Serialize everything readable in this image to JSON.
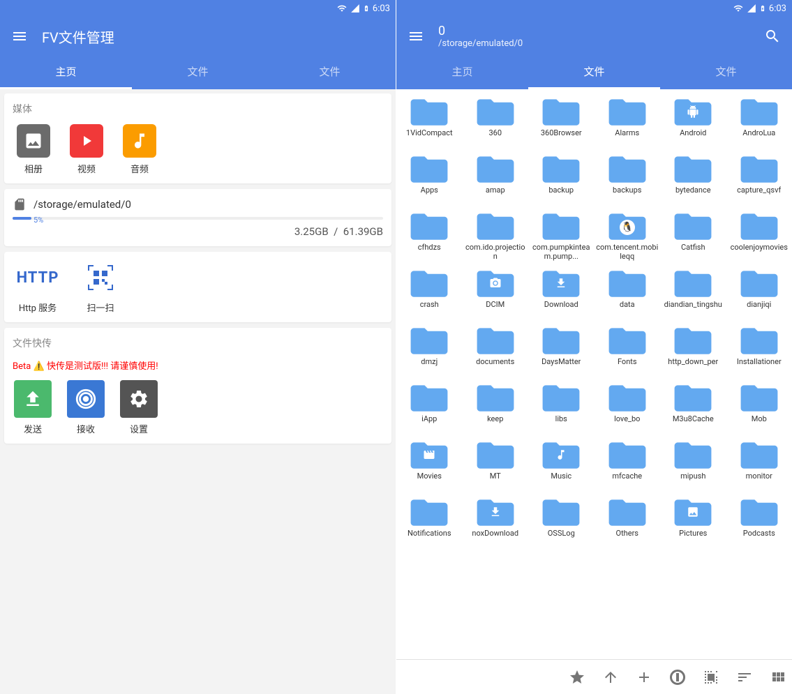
{
  "status": {
    "time": "6:03"
  },
  "phone1": {
    "title": "FV文件管理",
    "tabs": [
      "主页",
      "文件",
      "文件"
    ],
    "activeTab": 0,
    "media": {
      "title": "媒体",
      "items": [
        {
          "label": "相册",
          "bg": "#6b6b6b",
          "type": "image"
        },
        {
          "label": "视频",
          "bg": "#f13939",
          "type": "video"
        },
        {
          "label": "音频",
          "bg": "#fb9c00",
          "type": "audio"
        }
      ]
    },
    "storage": {
      "path": "/storage/emulated/0",
      "percent": "5%",
      "used": "3.25GB",
      "total": "61.39GB"
    },
    "tools": [
      {
        "label": "Http 服务",
        "type": "http"
      },
      {
        "label": "扫一扫",
        "type": "qr"
      }
    ],
    "transfer": {
      "title": "文件快传",
      "beta": "Beta ⚠️ 快传是测试版!!! 请谨慎使用!",
      "actions": [
        {
          "label": "发送",
          "bg": "#4bb96d",
          "type": "upload"
        },
        {
          "label": "接收",
          "bg": "#3a78d4",
          "type": "receive"
        },
        {
          "label": "设置",
          "bg": "#545454",
          "type": "settings"
        }
      ]
    }
  },
  "phone2": {
    "title": "0",
    "subtitle": "/storage/emulated/0",
    "tabs": [
      "主页",
      "文件",
      "文件"
    ],
    "activeTab": 1,
    "folders": [
      {
        "name": "1VidCompact"
      },
      {
        "name": "360"
      },
      {
        "name": "360Browser"
      },
      {
        "name": "Alarms"
      },
      {
        "name": "Android",
        "overlay": "android"
      },
      {
        "name": "AndroLua"
      },
      {
        "name": "Apps"
      },
      {
        "name": "amap"
      },
      {
        "name": "backup"
      },
      {
        "name": "backups"
      },
      {
        "name": "bytedance"
      },
      {
        "name": "capture_qsvf"
      },
      {
        "name": "cfhdzs"
      },
      {
        "name": "com.ido.projection"
      },
      {
        "name": "com.pumpkinteam.pump..."
      },
      {
        "name": "com.tencent.mobileqq",
        "overlay": "qq"
      },
      {
        "name": "Catfish"
      },
      {
        "name": "coolenjoymovies"
      },
      {
        "name": "crash"
      },
      {
        "name": "DCIM",
        "overlay": "camera"
      },
      {
        "name": "Download",
        "overlay": "download"
      },
      {
        "name": "data"
      },
      {
        "name": "diandian_tingshu"
      },
      {
        "name": "dianjiqi"
      },
      {
        "name": "dmzj"
      },
      {
        "name": "documents"
      },
      {
        "name": "DaysMatter"
      },
      {
        "name": "Fonts"
      },
      {
        "name": "http_down_per"
      },
      {
        "name": "Installationer"
      },
      {
        "name": "iApp"
      },
      {
        "name": "keep"
      },
      {
        "name": "libs"
      },
      {
        "name": "love_bo"
      },
      {
        "name": "M3u8Cache"
      },
      {
        "name": "Mob"
      },
      {
        "name": "Movies",
        "overlay": "movie"
      },
      {
        "name": "MT"
      },
      {
        "name": "Music",
        "overlay": "music"
      },
      {
        "name": "mfcache"
      },
      {
        "name": "mipush"
      },
      {
        "name": "monitor"
      },
      {
        "name": "Notifications"
      },
      {
        "name": "noxDownload",
        "overlay": "download"
      },
      {
        "name": "OSSLog"
      },
      {
        "name": "Others"
      },
      {
        "name": "Pictures",
        "overlay": "picture"
      },
      {
        "name": "Podcasts"
      }
    ]
  }
}
